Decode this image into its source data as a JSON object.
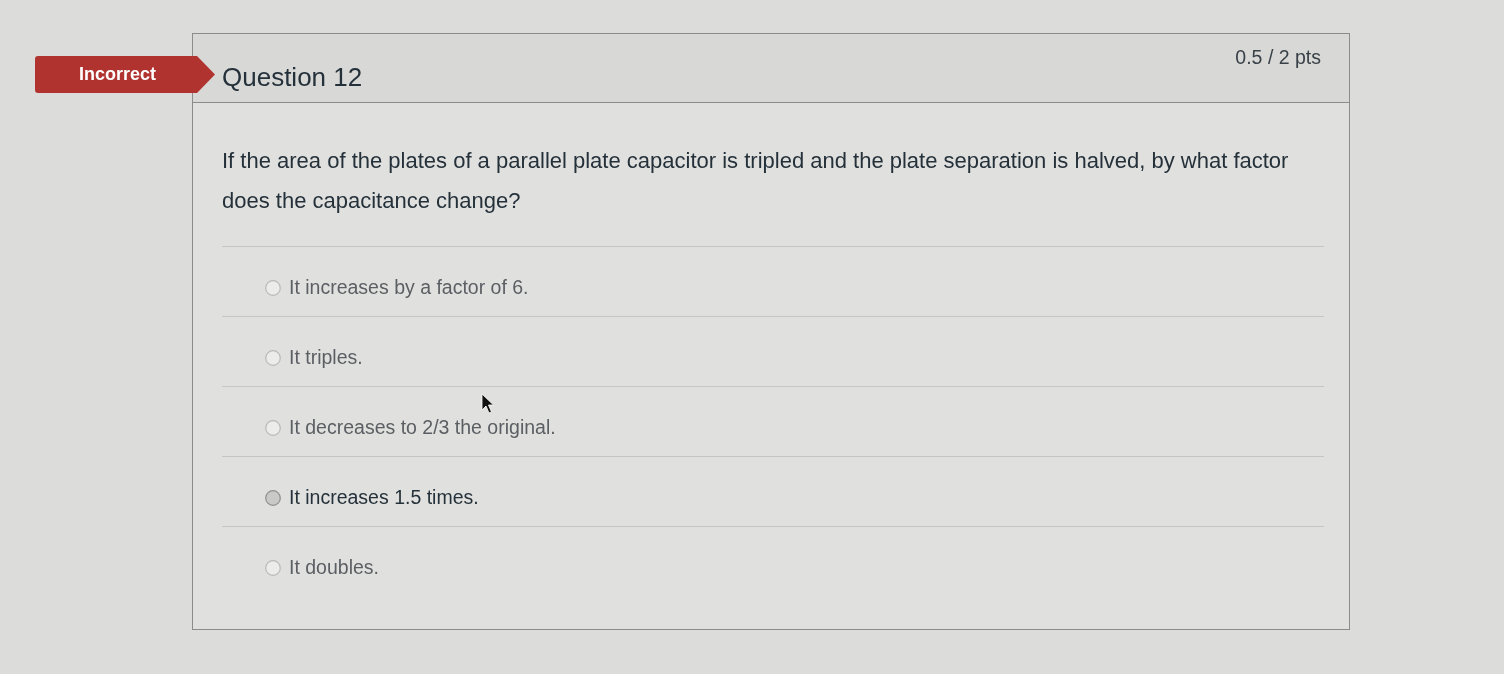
{
  "result_banner": {
    "label": "Incorrect",
    "correct": false
  },
  "question": {
    "title": "Question 12",
    "score": "0.5 / 2 pts",
    "text": "If the area of the plates of a parallel plate capacitor is tripled and the plate separation is halved, by what factor does the capacitance change?"
  },
  "answers": [
    {
      "label": "It increases by a factor of 6.",
      "selected": false
    },
    {
      "label": "It triples.",
      "selected": false
    },
    {
      "label": "It decreases to 2/3 the original.",
      "selected": false
    },
    {
      "label": "It increases 1.5 times.",
      "selected": true
    },
    {
      "label": "It doubles.",
      "selected": false
    }
  ]
}
